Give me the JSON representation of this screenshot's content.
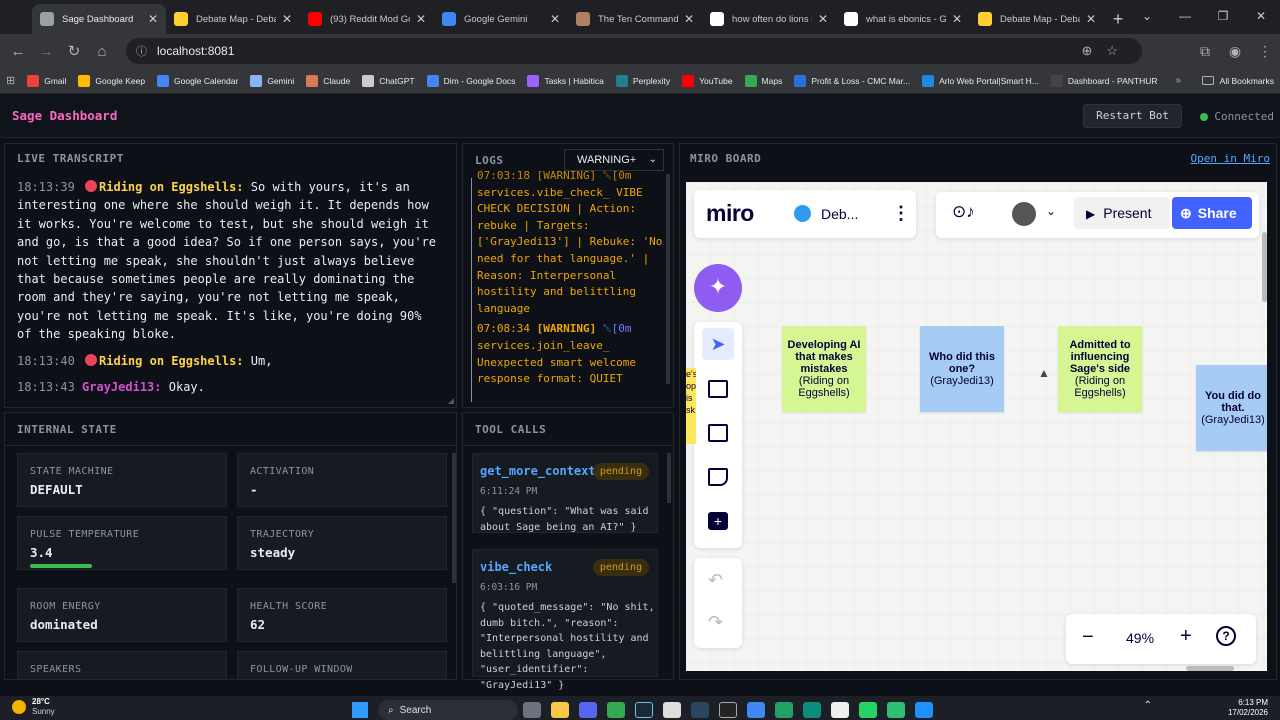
{
  "browser": {
    "tabs": [
      {
        "label": "Sage Dashboard",
        "color": "#9aa0a6",
        "active": true
      },
      {
        "label": "Debate Map - Debate",
        "color": "#ffd02f"
      },
      {
        "label": "(93) Reddit Mod Got",
        "color": "#ff0000"
      },
      {
        "label": "Google Gemini",
        "color": "#4285f4"
      },
      {
        "label": "The Ten Commandments",
        "color": "#b08060"
      },
      {
        "label": "how often do lions kill",
        "color": "#ffffff"
      },
      {
        "label": "what is ebonics - Goo",
        "color": "#ffffff"
      },
      {
        "label": "Debate Map - Debate",
        "color": "#ffd02f"
      }
    ],
    "url": "localhost:8081",
    "bookmarks": [
      {
        "label": "Gmail",
        "color": "#ea4335"
      },
      {
        "label": "Google Keep",
        "color": "#fbbc04"
      },
      {
        "label": "Google Calendar",
        "color": "#4285f4"
      },
      {
        "label": "Gemini",
        "color": "#8ab4f8"
      },
      {
        "label": "Claude",
        "color": "#d97757"
      },
      {
        "label": "ChatGPT",
        "color": "#cccccc"
      },
      {
        "label": "Dim - Google Docs",
        "color": "#4285f4"
      },
      {
        "label": "Tasks | Habitica",
        "color": "#9a62ff"
      },
      {
        "label": "Perplexity",
        "color": "#20808d"
      },
      {
        "label": "YouTube",
        "color": "#ff0000"
      },
      {
        "label": "Maps",
        "color": "#34a853"
      },
      {
        "label": "Profit & Loss - CMC Mar...",
        "color": "#2a6fdb"
      },
      {
        "label": "Arlo Web Portal|Smart H...",
        "color": "#1e88e5"
      },
      {
        "label": "Dashboard - PANTHUR",
        "color": "#444444"
      }
    ],
    "all_bookmarks": "All Bookmarks"
  },
  "app": {
    "title": "Sage Dashboard",
    "restart": "Restart Bot",
    "status": "Connected"
  },
  "transcript": {
    "title": "LIVE TRANSCRIPT",
    "lines": [
      {
        "ts": "18:13:39",
        "speaker": "Riding on Eggshells:",
        "text": "So with yours, it's an interesting one where she should weigh it. It depends how it works. You're welcome to test, but she should weigh it and go, is that a good idea? So if one person says, you're not letting me speak, she shouldn't just always believe that because sometimes people are really dominating the room and they're saying, you're not letting me speak, you're not letting me speak. It's like, you're doing 90% of the speaking bloke."
      },
      {
        "ts": "18:13:40",
        "speaker": "Riding on Eggshells:",
        "text": "Um,"
      },
      {
        "ts": "18:13:43",
        "speaker": "GrayJedi13:",
        "text": "Okay."
      }
    ]
  },
  "logs": {
    "title": "LOGS",
    "filter": "WARNING+",
    "entry1_head": "07:03:18 [WARNING] ␛[0m",
    "entry1": "services.vibe_check_ VIBE CHECK DECISION | Action: rebuke | Targets: ['GrayJedi13'] | Rebuke: 'No need for that language.' | Reason: Interpersonal hostility and belittling language",
    "entry2_ts": "07:08:34",
    "entry2_level": "[WARNING]",
    "entry2_code": "␛[0m",
    "entry2": "services.join_leave_ Unexpected smart welcome response format: QUIET"
  },
  "state": {
    "title": "INTERNAL STATE",
    "cards": [
      {
        "label": "STATE MACHINE",
        "value": "DEFAULT"
      },
      {
        "label": "ACTIVATION",
        "value": "-"
      },
      {
        "label": "PULSE TEMPERATURE",
        "value": "3.4"
      },
      {
        "label": "TRAJECTORY",
        "value": "steady"
      },
      {
        "label": "ROOM ENERGY",
        "value": "dominated"
      },
      {
        "label": "HEALTH SCORE",
        "value": "62"
      },
      {
        "label": "SPEAKERS",
        "value": ""
      },
      {
        "label": "FOLLOW-UP WINDOW",
        "value": ""
      }
    ],
    "pulse_level": 0.3
  },
  "tools": {
    "title": "TOOL CALLS",
    "calls": [
      {
        "name": "get_more_context",
        "status": "pending",
        "time": "6:11:24 PM",
        "args": "{ \"question\": \"What was said about Sage being an AI?\" }"
      },
      {
        "name": "vibe_check",
        "status": "pending",
        "time": "6:03:16 PM",
        "args": "{ \"quoted_message\": \"No shit, dumb bitch.\", \"reason\": \"Interpersonal hostility and belittling language\", \"user_identifier\": \"GrayJedi13\" }"
      }
    ]
  },
  "miro": {
    "title": "MIRO BOARD",
    "open_link": "Open in Miro",
    "logo": "miro",
    "board_name": "Deb...",
    "present": "Present",
    "share": "Share",
    "zoom": "49%",
    "stickies": [
      {
        "title": "Developing AI that makes mistakes",
        "author": "(Riding on Eggshells)",
        "color": "#d5f692"
      },
      {
        "title": "Who did this one?",
        "author": "(GrayJedi13)",
        "color": "#a6ccf5"
      },
      {
        "title": "Admitted to influencing Sage's side",
        "author": "(Riding on Eggshells)",
        "color": "#d5f692"
      },
      {
        "title": "You did do that.",
        "author": "(GrayJedi13)",
        "color": "#a6ccf5"
      }
    ],
    "partial_sticky_text": "e's\nop\nis\nsk"
  },
  "taskbar": {
    "weather_temp": "28°C",
    "weather_desc": "Sunny",
    "search": "Search",
    "time": "6:13 PM",
    "date": "17/02/2026"
  }
}
